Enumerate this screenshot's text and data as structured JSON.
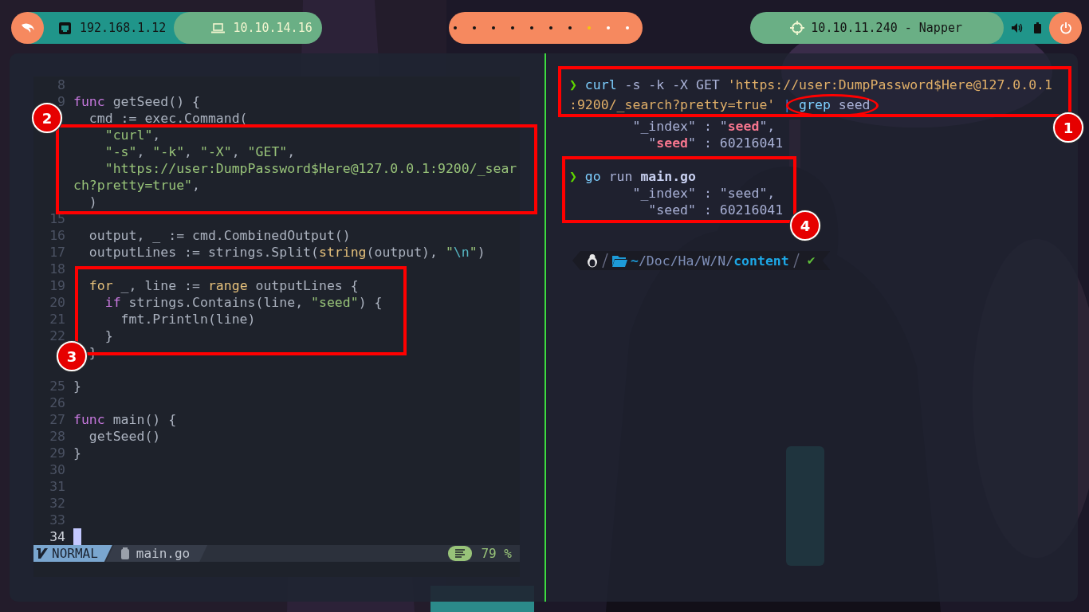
{
  "topbar": {
    "left": [
      {
        "kind": "ethernet",
        "text": "192.168.1.12"
      },
      {
        "kind": "laptop",
        "text": "10.10.14.16"
      }
    ],
    "workspaces": [
      {
        "selected": false,
        "occupied": true
      },
      {
        "selected": false,
        "occupied": true
      },
      {
        "selected": false,
        "occupied": true
      },
      {
        "selected": false,
        "occupied": true
      },
      {
        "selected": false,
        "occupied": true
      },
      {
        "selected": false,
        "occupied": true
      },
      {
        "selected": false,
        "occupied": true
      },
      {
        "selected": true,
        "occupied": true
      },
      {
        "selected": false,
        "occupied": false
      },
      {
        "selected": false,
        "occupied": false
      }
    ],
    "target": "10.10.11.240 - Napper"
  },
  "editor": {
    "lines": [
      {
        "number": "8",
        "current": false
      },
      {
        "number": "9",
        "current": false,
        "tokens": [
          {
            "kind": "keyword",
            "text": "func"
          },
          {
            "kind": "plain",
            "text": " getSeed() {"
          }
        ]
      },
      {
        "current": false,
        "tokens": [
          {
            "kind": "plain",
            "text": "  cmd := exec.Command("
          }
        ]
      },
      {
        "current": false,
        "tokens": [
          {
            "kind": "string",
            "text": "    \"curl\""
          },
          {
            "kind": "plain",
            "text": ","
          }
        ]
      },
      {
        "current": false,
        "tokens": [
          {
            "kind": "string",
            "text": "    \"-s\""
          },
          {
            "kind": "plain",
            "text": ", "
          },
          {
            "kind": "string",
            "text": "\"-k\""
          },
          {
            "kind": "plain",
            "text": ", "
          },
          {
            "kind": "string",
            "text": "\"-X\""
          },
          {
            "kind": "plain",
            "text": ", "
          },
          {
            "kind": "string",
            "text": "\"GET\""
          },
          {
            "kind": "plain",
            "text": ","
          }
        ]
      },
      {
        "current": false,
        "tokens": [
          {
            "kind": "string",
            "text": "    \"https://user:DumpPassword$Here@127.0.0.1:9200/_sear"
          }
        ]
      },
      {
        "current": false,
        "tokens": [
          {
            "kind": "string",
            "text": "ch?pretty=true\""
          },
          {
            "kind": "plain",
            "text": ","
          }
        ]
      },
      {
        "current": false,
        "tokens": [
          {
            "kind": "plain",
            "text": "  )"
          }
        ]
      },
      {
        "number": "15",
        "current": false
      },
      {
        "number": "16",
        "current": false,
        "tokens": [
          {
            "kind": "plain",
            "text": "  output, _ := cmd.CombinedOutput()"
          }
        ]
      },
      {
        "number": "17",
        "current": false,
        "tokens": [
          {
            "kind": "plain",
            "text": "  outputLines := strings.Split("
          },
          {
            "kind": "type",
            "text": "string"
          },
          {
            "kind": "plain",
            "text": "(output), "
          },
          {
            "kind": "string",
            "text": "\""
          },
          {
            "kind": "escape",
            "text": "\\n"
          },
          {
            "kind": "string",
            "text": "\""
          },
          {
            "kind": "plain",
            "text": ")"
          }
        ]
      },
      {
        "number": "18",
        "current": false
      },
      {
        "number": "19",
        "current": false,
        "tokens": [
          {
            "kind": "control",
            "text": "  for"
          },
          {
            "kind": "plain",
            "text": " _, line := "
          },
          {
            "kind": "control",
            "text": "range"
          },
          {
            "kind": "plain",
            "text": " outputLines {"
          }
        ]
      },
      {
        "number": "20",
        "current": false,
        "tokens": [
          {
            "kind": "keyword",
            "text": "    if"
          },
          {
            "kind": "plain",
            "text": " strings.Contains(line, "
          },
          {
            "kind": "string",
            "text": "\"seed\""
          },
          {
            "kind": "plain",
            "text": ") {"
          }
        ]
      },
      {
        "number": "21",
        "current": false,
        "tokens": [
          {
            "kind": "plain",
            "text": "      fmt.Println(line)"
          }
        ]
      },
      {
        "number": "22",
        "current": false,
        "tokens": [
          {
            "kind": "plain",
            "text": "    }"
          }
        ]
      },
      {
        "current": false,
        "tokens": [
          {
            "kind": "plain",
            "text": "  }"
          }
        ]
      },
      {
        "current": false
      },
      {
        "number": "25",
        "current": false,
        "tokens": [
          {
            "kind": "plain",
            "text": "}"
          }
        ]
      },
      {
        "number": "26",
        "current": false
      },
      {
        "number": "27",
        "current": false,
        "tokens": [
          {
            "kind": "keyword",
            "text": "func"
          },
          {
            "kind": "plain",
            "text": " main() {"
          }
        ]
      },
      {
        "number": "28",
        "current": false,
        "tokens": [
          {
            "kind": "plain",
            "text": "  getSeed()"
          }
        ]
      },
      {
        "number": "29",
        "current": false,
        "tokens": [
          {
            "kind": "plain",
            "text": "}"
          }
        ]
      },
      {
        "number": "30",
        "current": false
      },
      {
        "number": "31",
        "current": false
      },
      {
        "number": "32",
        "current": false
      },
      {
        "number": "33",
        "current": false
      },
      {
        "number": "34",
        "current": true
      }
    ],
    "statusline": {
      "mode": "NORMAL",
      "file": "main.go",
      "percent": "79 %"
    }
  },
  "terminal": {
    "entries": [
      {
        "command": [
          [
            {
              "kind": "prompt",
              "text": "❯"
            },
            {
              "kind": "command",
              "text": " curl"
            },
            {
              "kind": "arg",
              "text": " -s -k -X GET "
            },
            {
              "kind": "string",
              "text": "'https://user:DumpPassword$Here@127.0.0.1"
            }
          ],
          {
            "segments": [
              {
                "kind": "string",
                "text": ":9200/_search?pretty=true' "
              },
              {
                "kind": "pipe",
                "text": "|"
              }
            ],
            "circled": [
              {
                "kind": "command",
                "text": " grep"
              },
              {
                "kind": "arg",
                "text": " seed"
              }
            ]
          }
        ],
        "output": [
          [
            {
              "kind": "output",
              "text": "        \"_index\" : \""
            },
            {
              "kind": "match",
              "text": "seed"
            },
            {
              "kind": "output",
              "text": "\","
            }
          ],
          [
            {
              "kind": "output",
              "text": "          \""
            },
            {
              "kind": "match",
              "text": "seed"
            },
            {
              "kind": "output",
              "text": "\" : 60216041"
            }
          ]
        ]
      },
      {
        "command": [
          [
            {
              "kind": "prompt",
              "text": "❯"
            },
            {
              "kind": "command",
              "text": " go"
            },
            {
              "kind": "arg",
              "text": " run "
            },
            {
              "kind": "bold",
              "text": "main.go"
            }
          ]
        ],
        "output": [
          [
            {
              "kind": "output",
              "text": "        \"_index\" : \"seed\","
            }
          ],
          [
            {
              "kind": "output",
              "text": "          \"seed\" : 60216041"
            }
          ]
        ]
      }
    ],
    "prompt": {
      "home": "~",
      "path": "/Doc/Ha/W/N/",
      "directory": "content",
      "status": "✔"
    }
  },
  "annotations": [
    {
      "label": "1"
    },
    {
      "label": "2"
    },
    {
      "label": "3"
    },
    {
      "label": "4"
    }
  ]
}
